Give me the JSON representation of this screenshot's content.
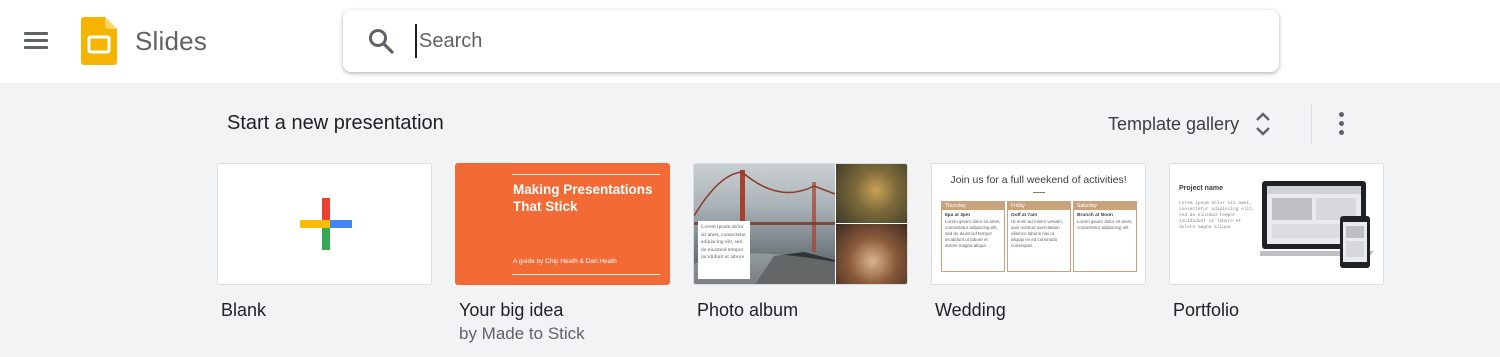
{
  "app": {
    "title": "Slides"
  },
  "search": {
    "placeholder": "Search",
    "value": ""
  },
  "section": {
    "title": "Start a new presentation",
    "gallery_label": "Template gallery"
  },
  "icons": {
    "menu": "hamburger-menu-icon",
    "logo": "slides-logo-icon",
    "search": "search-icon",
    "gallery_toggle": "unfold-more-icon",
    "more": "more-vert-icon",
    "blank": "plus-icon"
  },
  "colors": {
    "slides_yellow": "#f4b400",
    "idea_orange": "#f26a35",
    "wedding_accent": "#c9a27e"
  },
  "templates": [
    {
      "name": "Blank",
      "author": ""
    },
    {
      "name": "Your big idea",
      "author": "by Made to Stick",
      "thumb_title": "Making Presentations That Stick",
      "thumb_subtitle": "A guide by Chip Heath & Dan Heath"
    },
    {
      "name": "Photo album",
      "author": "",
      "thumb_caption": "Lorem ipsum dolor sit amet, consectetur adipiscing elit, sed do eiusmod tempor incididunt ut labore"
    },
    {
      "name": "Wedding",
      "author": "",
      "thumb_title": "Join us for a full weekend of activities!",
      "days": [
        {
          "day": "Thursday",
          "time": "5pa at 3pm",
          "text": "Lorem ipsum dolor sit amet, consectetur adipiscing elit, sed do eiusmod tempor incididunt ut labore et dolore magna aliqua"
        },
        {
          "day": "Friday",
          "time": "Golf at 7am",
          "text": "Ut enim ad minim veniam, quis nostrud exercitation ullamco laboris nisi ut aliquip ex ea commodo consequat."
        },
        {
          "day": "Saturday",
          "time": "Brunch at Noon",
          "text": "Lorem ipsum dolor sit amet, consectetur adipiscing elit"
        }
      ]
    },
    {
      "name": "Portfolio",
      "author": "",
      "thumb_title": "Project name",
      "thumb_text": "Lorem ipsum dolor sit amet, consectetur adipiscing elit, sed do eiusmod tempor incididunt ut labore et dolore magna aliqua"
    }
  ]
}
